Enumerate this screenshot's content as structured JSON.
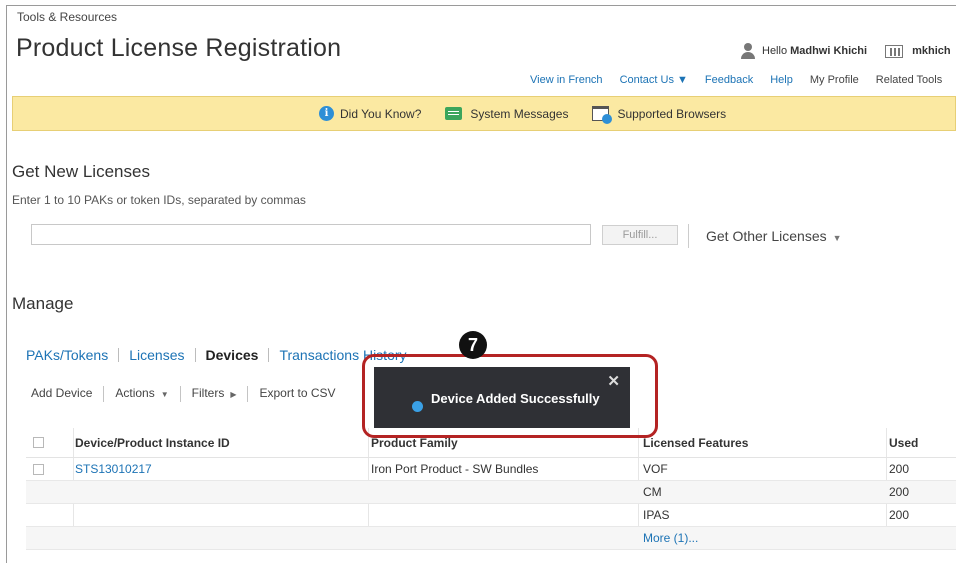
{
  "header": {
    "breadcrumb": "Tools & Resources",
    "title": "Product License Registration",
    "greeting_prefix": "Hello",
    "user_name": "Madhwi Khichi",
    "account": "mkhich"
  },
  "top_nav": [
    "View in French",
    "Contact Us ▼",
    "Feedback",
    "Help",
    "My Profile",
    "Related Tools"
  ],
  "banner": {
    "did_you_know": "Did You Know?",
    "system_messages": "System Messages",
    "supported_browsers": "Supported Browsers"
  },
  "get_licenses": {
    "title": "Get New Licenses",
    "hint": "Enter 1 to 10 PAKs or token IDs, separated by commas",
    "input_value": "",
    "fulfill_label": "Fulfill...",
    "get_other_label": "Get Other Licenses"
  },
  "manage": {
    "title": "Manage",
    "tabs": [
      "PAKs/Tokens",
      "Licenses",
      "Devices",
      "Transactions History"
    ],
    "active_tab": "Devices",
    "toolbar": {
      "add_device": "Add Device",
      "actions": "Actions",
      "filters": "Filters",
      "export": "Export to CSV"
    }
  },
  "table": {
    "columns": [
      "Device/Product Instance ID",
      "Product Family",
      "Licensed Features",
      "Used"
    ],
    "rows": [
      {
        "device_id": "STS13010217",
        "family": "Iron Port Product - SW Bundles",
        "feature": "VOF",
        "used": "200"
      },
      {
        "device_id": "",
        "family": "",
        "feature": "CM",
        "used": "200"
      },
      {
        "device_id": "",
        "family": "",
        "feature": "IPAS",
        "used": "200"
      },
      {
        "device_id": "",
        "family": "",
        "feature": "More (1)...",
        "used": ""
      }
    ]
  },
  "toast": {
    "message": "Device Added Successfully",
    "close": "✕"
  },
  "callout": {
    "step": "7"
  },
  "colors": {
    "link": "#1c73b5",
    "banner_bg": "#fbe9a2",
    "toast_bg": "#2f3035",
    "highlight": "#b42323"
  }
}
